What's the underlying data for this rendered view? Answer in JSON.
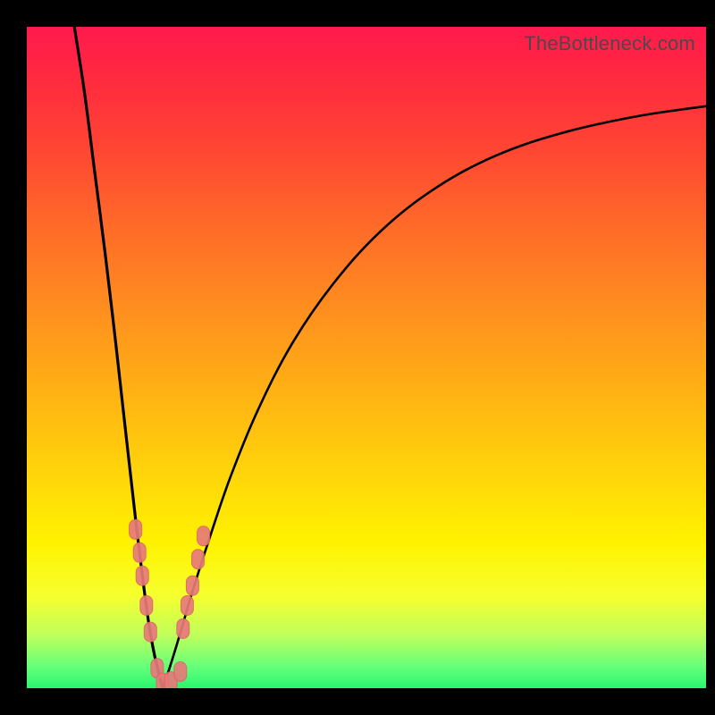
{
  "watermark": "TheBottleneck.com",
  "colors": {
    "frame": "#000000",
    "curve": "#000000",
    "marker_fill": "#e77a7a",
    "marker_stroke": "#d96666",
    "gradient_top": "#ff1a4d",
    "gradient_bottom": "#29f56e"
  },
  "chart_data": {
    "type": "line",
    "title": "",
    "xlabel": "",
    "ylabel": "",
    "xlim": [
      0,
      100
    ],
    "ylim": [
      0,
      100
    ],
    "grid": false,
    "legend": false,
    "note": "Axes have no tick labels; x and y are read as percentage of plot width/height. y is bottleneck percentage (0 at bottom = no bottleneck, 100 at top).",
    "series": [
      {
        "name": "left-branch",
        "x": [
          7,
          8.5,
          10,
          11.5,
          13,
          14.2,
          15.3,
          16.3,
          17.2,
          18,
          18.8,
          19.5,
          20
        ],
        "y": [
          100,
          90,
          78,
          66,
          53,
          42,
          32,
          23,
          15.5,
          9.5,
          5,
          2,
          0
        ]
      },
      {
        "name": "right-branch",
        "x": [
          20,
          21,
          22.5,
          24.5,
          27,
          30,
          34,
          39,
          45,
          52,
          60,
          69,
          79,
          90,
          100
        ],
        "y": [
          0,
          3,
          8,
          15,
          23,
          32,
          42,
          52,
          61,
          69,
          75.5,
          80.5,
          84,
          86.5,
          88
        ]
      }
    ],
    "markers": {
      "name": "sample-points",
      "shape": "rounded-capsule",
      "points": [
        {
          "x": 16.0,
          "y": 24.0
        },
        {
          "x": 16.6,
          "y": 20.5
        },
        {
          "x": 17.0,
          "y": 17.0
        },
        {
          "x": 17.6,
          "y": 12.5
        },
        {
          "x": 18.2,
          "y": 8.5
        },
        {
          "x": 19.2,
          "y": 3.0
        },
        {
          "x": 20.0,
          "y": 0.8
        },
        {
          "x": 21.2,
          "y": 1.0
        },
        {
          "x": 22.6,
          "y": 2.5
        },
        {
          "x": 23.0,
          "y": 9.0
        },
        {
          "x": 23.6,
          "y": 12.5
        },
        {
          "x": 24.4,
          "y": 15.5
        },
        {
          "x": 25.2,
          "y": 19.5
        },
        {
          "x": 26.0,
          "y": 23.0
        }
      ]
    }
  }
}
